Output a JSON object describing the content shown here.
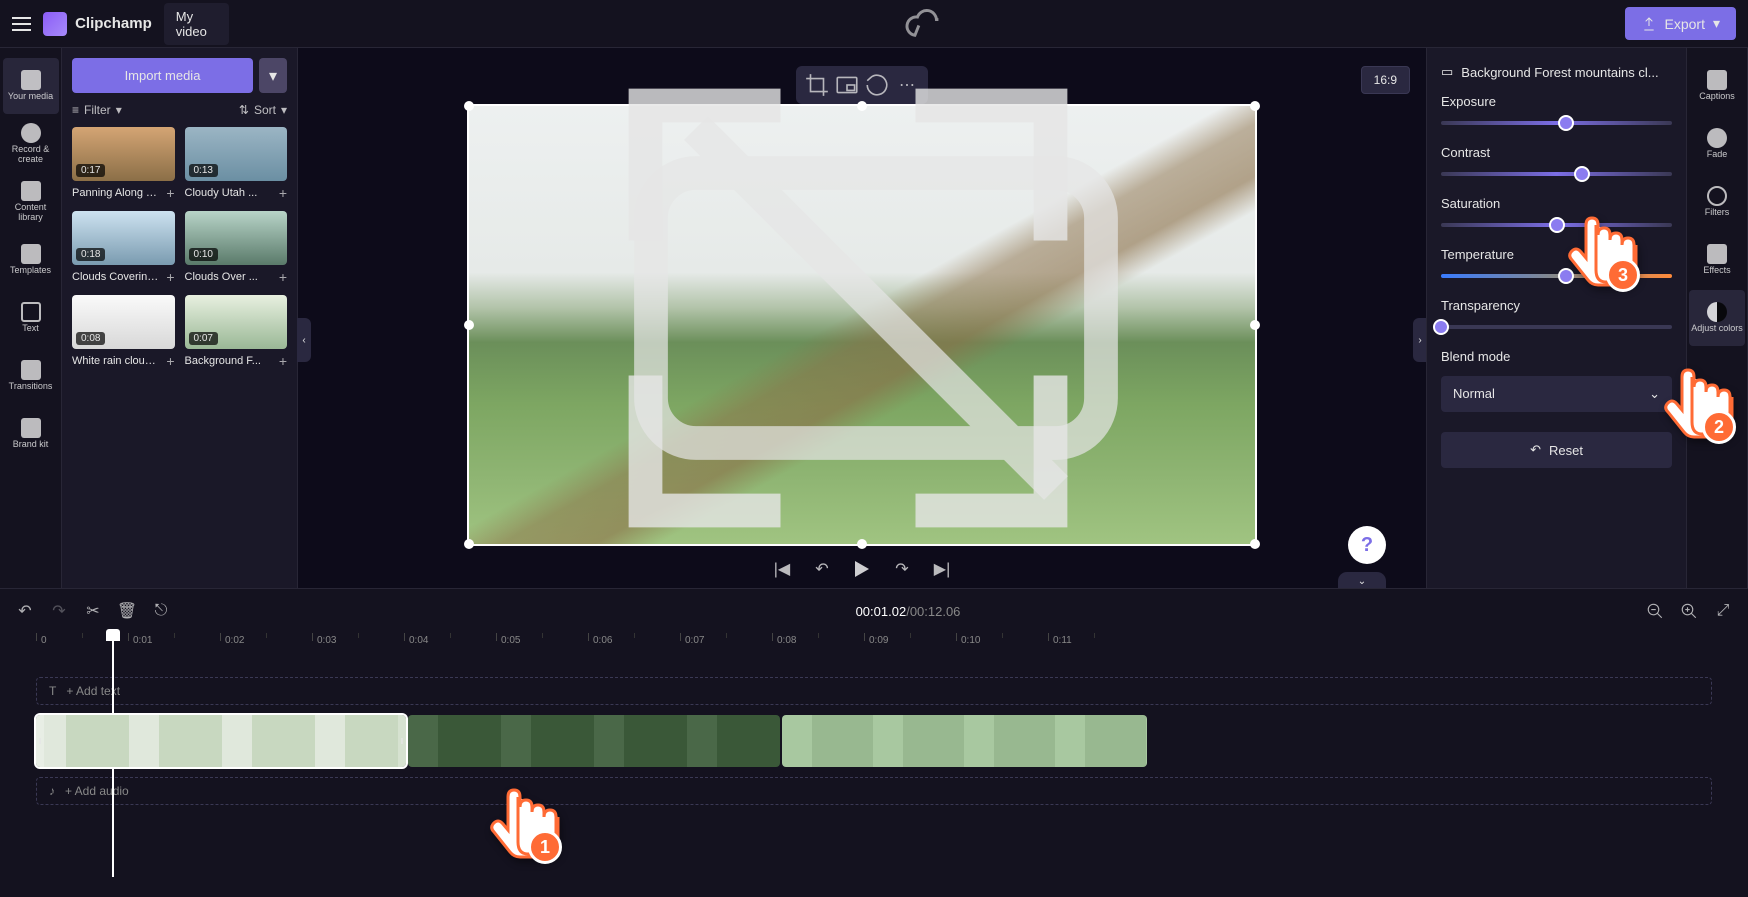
{
  "app": {
    "name": "Clipchamp",
    "video_title": "My video"
  },
  "export": {
    "label": "Export"
  },
  "left_rail": [
    {
      "label": "Your media"
    },
    {
      "label": "Record & create"
    },
    {
      "label": "Content library"
    },
    {
      "label": "Templates"
    },
    {
      "label": "Text"
    },
    {
      "label": "Transitions"
    },
    {
      "label": "Brand kit"
    }
  ],
  "media_panel": {
    "import": "Import media",
    "filter": "Filter",
    "sort": "Sort",
    "items": [
      {
        "dur": "0:17",
        "name": "Panning Along T..."
      },
      {
        "dur": "0:13",
        "name": "Cloudy Utah ..."
      },
      {
        "dur": "0:18",
        "name": "Clouds Covering..."
      },
      {
        "dur": "0:10",
        "name": "Clouds Over ..."
      },
      {
        "dur": "0:08",
        "name": "White rain cloud..."
      },
      {
        "dur": "0:07",
        "name": "Background F..."
      }
    ]
  },
  "preview": {
    "aspect": "16:9"
  },
  "adjust": {
    "clip_name": "Background Forest mountains cl...",
    "exposure": {
      "label": "Exposure",
      "pos": 54
    },
    "contrast": {
      "label": "Contrast",
      "pos": 61
    },
    "saturation": {
      "label": "Saturation",
      "pos": 50
    },
    "temperature": {
      "label": "Temperature",
      "pos": 54
    },
    "transparency": {
      "label": "Transparency",
      "pos": 0
    },
    "blend_label": "Blend mode",
    "blend_value": "Normal",
    "reset": "Reset"
  },
  "right_rail": [
    {
      "label": "Captions"
    },
    {
      "label": "Fade"
    },
    {
      "label": "Filters"
    },
    {
      "label": "Effects"
    },
    {
      "label": "Adjust colors"
    }
  ],
  "timeline": {
    "current": "00:01.02",
    "total": "00:12.06",
    "add_text": "+ Add text",
    "add_audio": "+ Add audio",
    "ticks": [
      "0",
      "0:01",
      "0:02",
      "0:03",
      "0:04",
      "0:05",
      "0:06",
      "0:07",
      "0:08",
      "0:09",
      "0:10",
      "0:11"
    ]
  },
  "pointers": {
    "p1": "1",
    "p2": "2",
    "p3": "3"
  }
}
